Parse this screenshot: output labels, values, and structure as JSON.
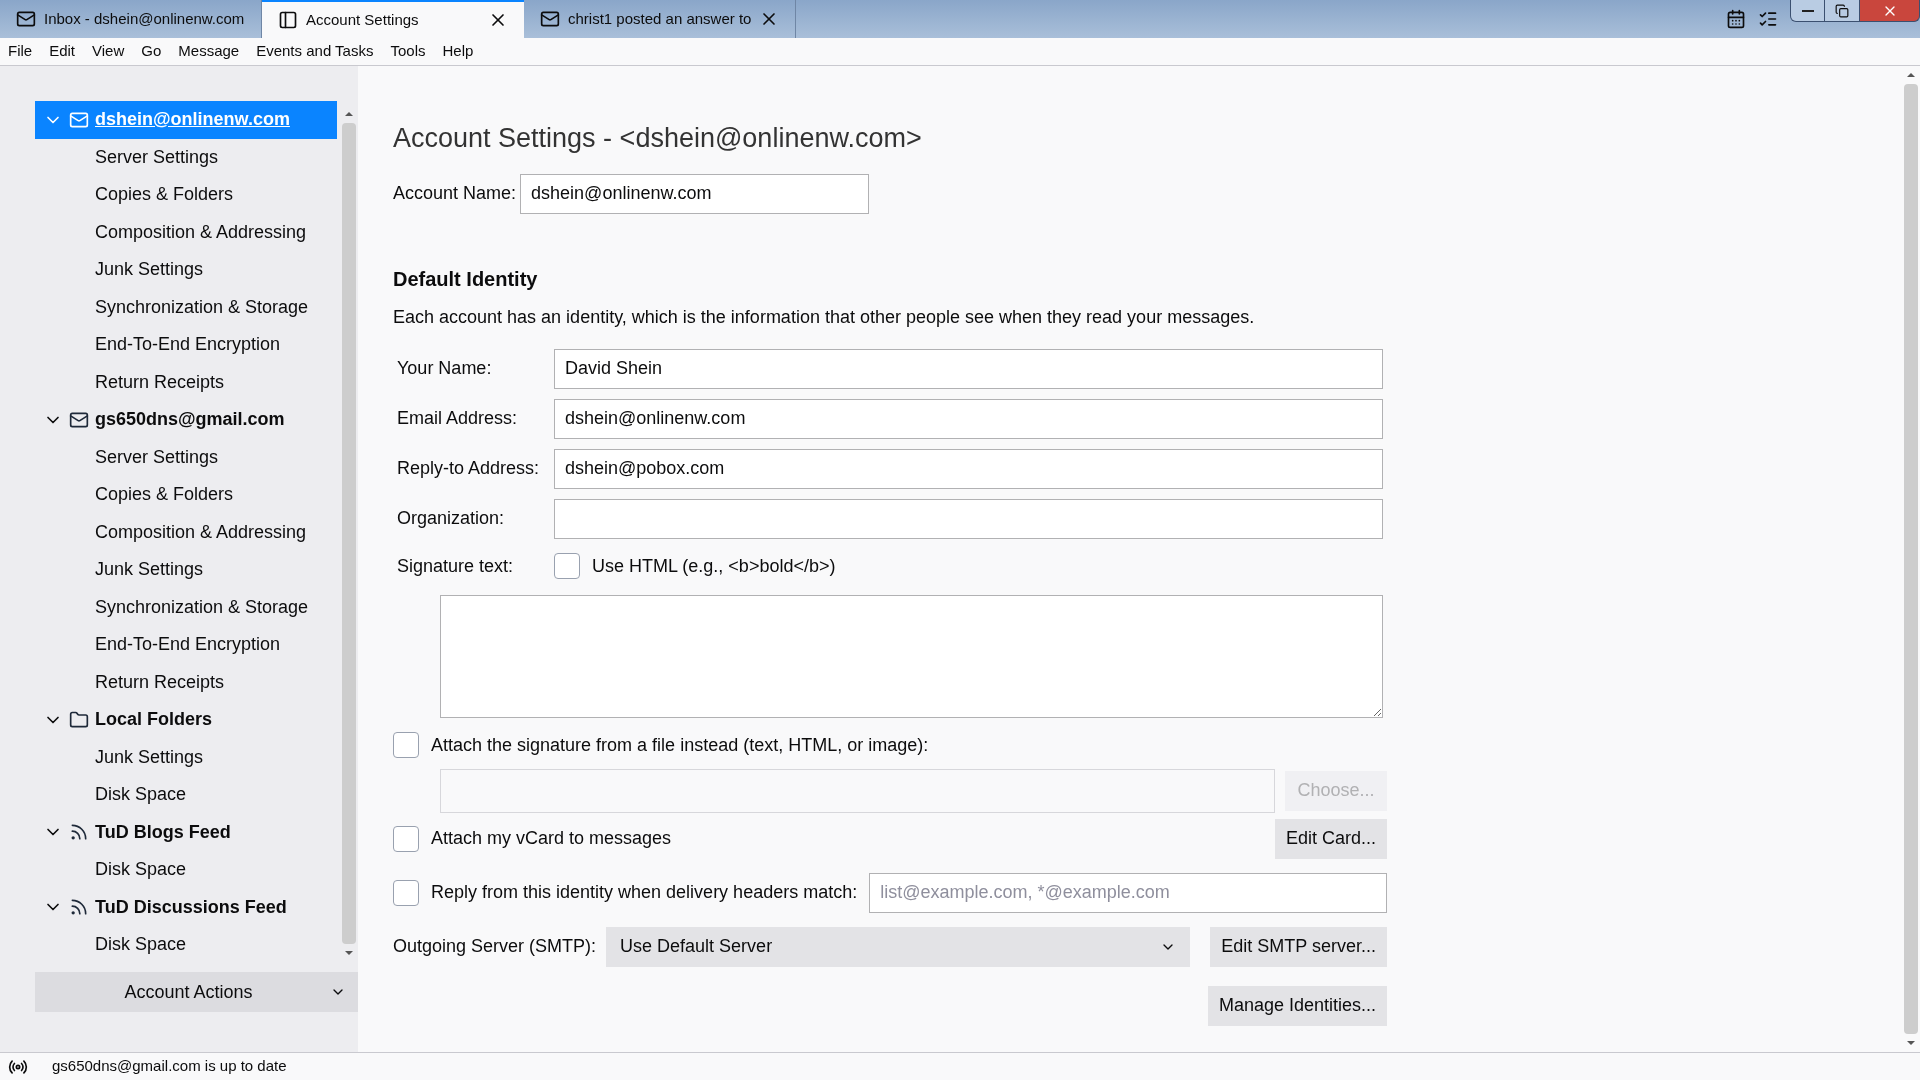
{
  "tabs": [
    {
      "label": "Inbox - dshein@onlinenw.com",
      "kind": "mail",
      "selected": false,
      "closable": false
    },
    {
      "label": "Account Settings",
      "kind": "settings",
      "selected": true,
      "closable": true
    },
    {
      "label": "christ1 posted an answer to",
      "kind": "mail",
      "selected": false,
      "closable": true
    }
  ],
  "menu": [
    "File",
    "Edit",
    "View",
    "Go",
    "Message",
    "Events and Tasks",
    "Tools",
    "Help"
  ],
  "sidebar": {
    "accounts": [
      {
        "label": "dshein@onlinenw.com",
        "kind": "mail",
        "selected": true,
        "expanded": true,
        "children": [
          {
            "label": "Server Settings"
          },
          {
            "label": "Copies & Folders"
          },
          {
            "label": "Composition & Addressing"
          },
          {
            "label": "Junk Settings"
          },
          {
            "label": "Synchronization & Storage"
          },
          {
            "label": "End-To-End Encryption"
          },
          {
            "label": "Return Receipts"
          }
        ]
      },
      {
        "label": "gs650dns@gmail.com",
        "kind": "mail",
        "selected": false,
        "expanded": true,
        "children": [
          {
            "label": "Server Settings"
          },
          {
            "label": "Copies & Folders"
          },
          {
            "label": "Composition & Addressing"
          },
          {
            "label": "Junk Settings"
          },
          {
            "label": "Synchronization & Storage"
          },
          {
            "label": "End-To-End Encryption"
          },
          {
            "label": "Return Receipts"
          }
        ]
      },
      {
        "label": "Local Folders",
        "kind": "folder",
        "selected": false,
        "expanded": true,
        "children": [
          {
            "label": "Junk Settings"
          },
          {
            "label": "Disk Space"
          }
        ]
      },
      {
        "label": "TuD Blogs Feed",
        "kind": "feed",
        "selected": false,
        "expanded": true,
        "children": [
          {
            "label": "Disk Space"
          }
        ]
      },
      {
        "label": "TuD Discussions Feed",
        "kind": "feed",
        "selected": false,
        "expanded": true,
        "children": [
          {
            "label": "Disk Space"
          }
        ]
      }
    ],
    "account_actions": "Account Actions"
  },
  "page": {
    "title": "Account Settings - <dshein@onlinenw.com>",
    "account_name": {
      "label": "Account Name:",
      "value": "dshein@onlinenw.com"
    },
    "identity_heading": "Default Identity",
    "identity_description": "Each account has an identity, which is the information that other people see when they read your messages.",
    "fields": [
      {
        "label": "Your Name:",
        "value": "David Shein"
      },
      {
        "label": "Email Address:",
        "value": "dshein@onlinenw.com"
      },
      {
        "label": "Reply-to Address:",
        "value": "dshein@pobox.com"
      },
      {
        "label": "Organization:"
      }
    ],
    "signature_label": "Signature text:",
    "use_html": {
      "label": "Use HTML (e.g., <b>bold</b>)",
      "checked": false
    },
    "attach_signature": {
      "label": "Attach the signature from a file instead (text, HTML, or image):",
      "checked": false
    },
    "choose_button": {
      "label": "Choose...",
      "disabled": true
    },
    "attach_vcard": {
      "label": "Attach my vCard to messages",
      "checked": false
    },
    "edit_card_button": "Edit Card...",
    "reply_from": {
      "label": "Reply from this identity when delivery headers match:",
      "checked": false,
      "placeholder": "list@example.com, *@example.com"
    },
    "outgoing_label": "Outgoing Server (SMTP):",
    "outgoing_value": "Use Default Server",
    "edit_smtp_button": "Edit SMTP server...",
    "manage_identities_button": "Manage Identities..."
  },
  "status_bar": {
    "text": "gs650dns@gmail.com is up to date"
  }
}
